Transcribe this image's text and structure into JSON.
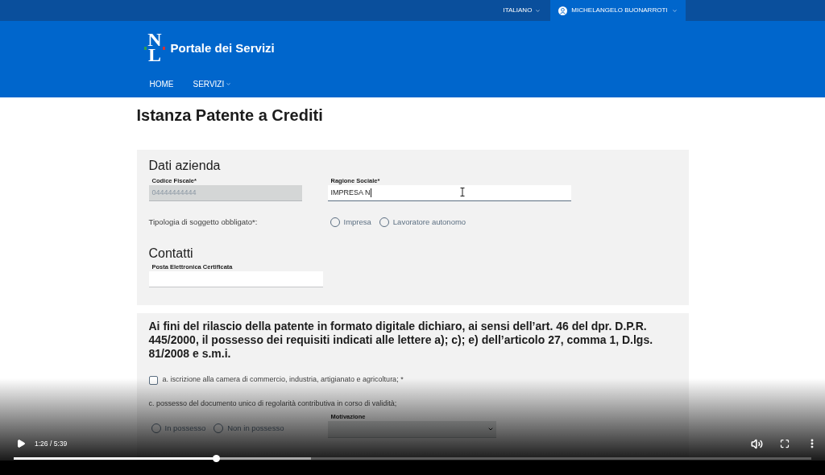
{
  "top_bar": {
    "language": "ITALIANO",
    "user": "MICHELANGELO BUONARROTI"
  },
  "header": {
    "logo": "NL",
    "title": "Portale dei Servizi"
  },
  "nav": [
    {
      "label": "HOME",
      "has_menu": false
    },
    {
      "label": "SERVIZI",
      "has_menu": true
    }
  ],
  "page_title": "Istanza Patente a Crediti",
  "company_section": {
    "title": "Dati azienda",
    "fields": [
      {
        "label": "Codice Fiscale*",
        "value": "04444444444",
        "disabled": true,
        "focused": false
      },
      {
        "label": "Ragione Sociale*",
        "value": "IMPRESA N",
        "disabled": false,
        "focused": true
      }
    ],
    "subject_type": {
      "label": "Tipologia di soggetto obbligato*:",
      "options": [
        {
          "label": "Impresa",
          "selected": false
        },
        {
          "label": "Lavoratore autonomo",
          "selected": false
        }
      ]
    }
  },
  "contacts_section": {
    "title": "Contatti",
    "fields": [
      {
        "label": "Posta Elettronica Certificata",
        "disabled": false,
        "focused": false
      }
    ]
  },
  "declaration": {
    "text": "Ai fini del rilascio della patente in formato digitale dichiaro, ai sensi dell’art. 46 del dpr. D.P.R. 445/2000, il possesso dei requisiti indicati alle lettere a); c); e) dell’articolo 27, comma 1, D.lgs. 81/2008 e s.m.i.",
    "items": [
      {
        "kind": "checkbox",
        "label": "a. iscrizione alla camera di commercio, industria, artigianato e agricoltura; *",
        "checked": false
      },
      {
        "kind": "radio_group",
        "label": "c. possesso del documento unico di regolarità contributiva in corso di validità;",
        "options": [
          {
            "label": "In possesso",
            "selected": false
          },
          {
            "label": "Non in possesso",
            "selected": false
          }
        ],
        "select": {
          "label": "Motivazione",
          "disabled": true
        }
      }
    ]
  },
  "player": {
    "playing": false,
    "time": "1:26 / 5:39",
    "progress": {
      "level": 0.254
    },
    "buffered": {
      "level": 0.373
    }
  }
}
